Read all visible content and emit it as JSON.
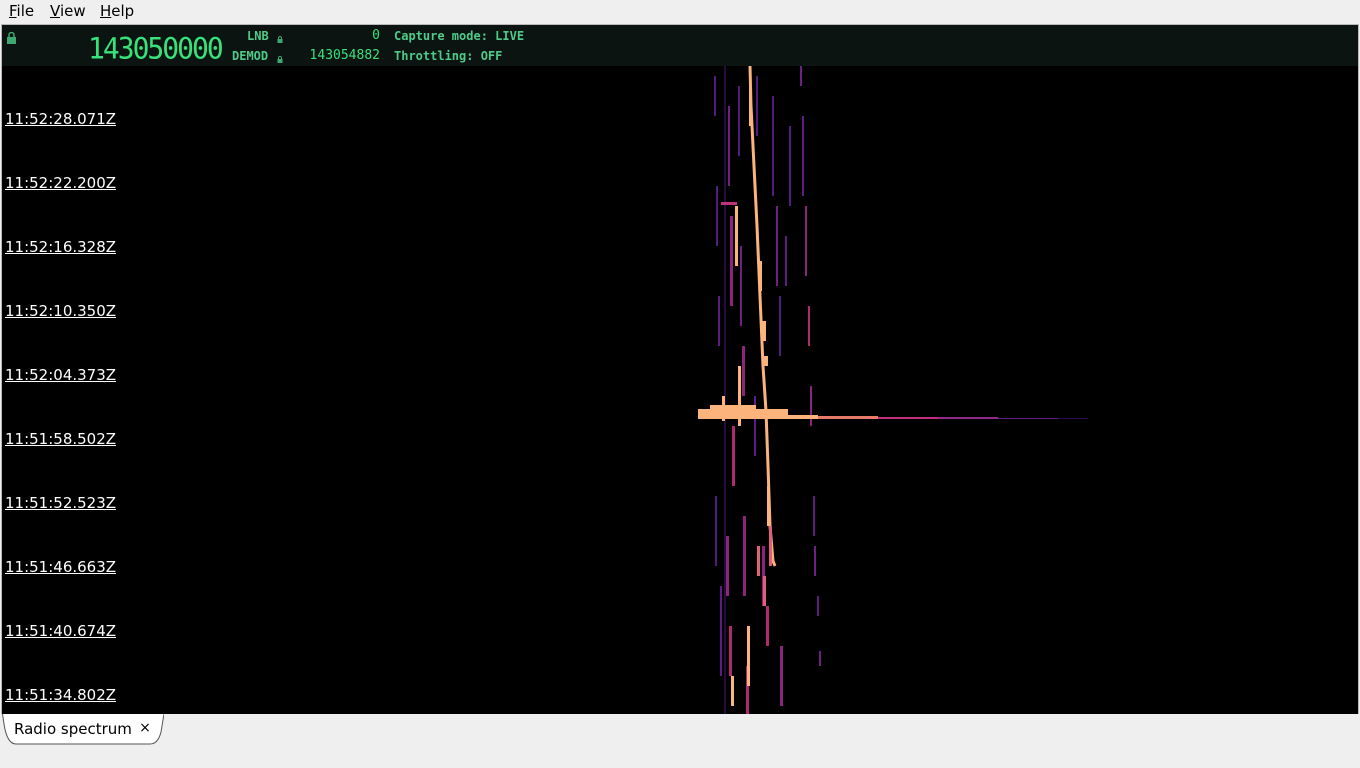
{
  "menu": {
    "file": "File",
    "view": "View",
    "help": "Help"
  },
  "header": {
    "big_frequency": "143050000",
    "lnb_label": "LNB",
    "lnb_value": "0",
    "demod_label": "DEMOD",
    "demod_value": "143054882",
    "capture_mode": "Capture mode: LIVE",
    "throttling": "Throttling: OFF"
  },
  "waterfall": {
    "timestamps": [
      "11:52:28.071Z",
      "11:52:22.200Z",
      "11:52:16.328Z",
      "11:52:10.350Z",
      "11:52:04.373Z",
      "11:51:58.502Z",
      "11:51:52.523Z",
      "11:51:46.663Z",
      "11:51:40.674Z",
      "11:51:34.802Z"
    ]
  },
  "tabs": [
    {
      "label": "Radio spectrum",
      "close": "×"
    }
  ],
  "colors": {
    "header_bg": "#0b1411",
    "header_text": "#4ecb89",
    "signal_hot": "#fcb47c",
    "signal_mid": "#c2307a",
    "signal_low": "#5b1e8c"
  }
}
